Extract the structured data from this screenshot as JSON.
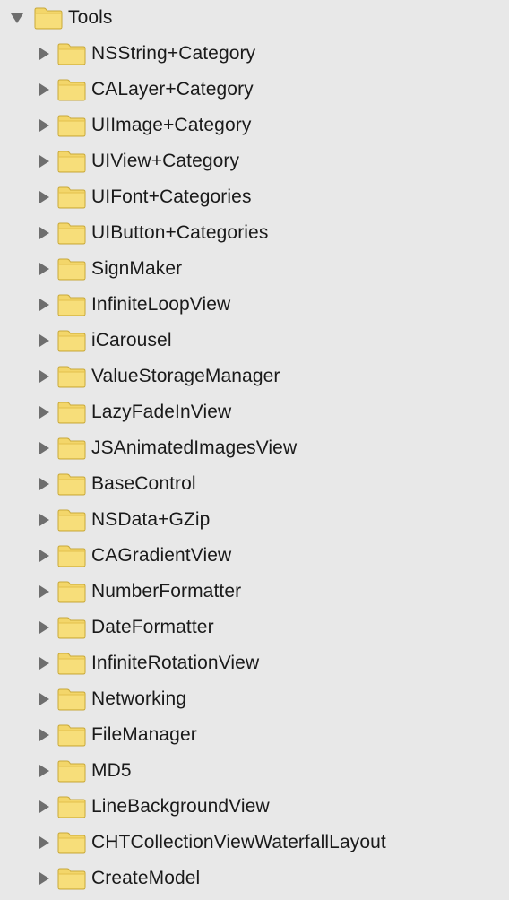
{
  "root": {
    "label": "Tools",
    "expanded": true,
    "icon": "folder-icon",
    "disclosure_icon": "triangle-down-icon"
  },
  "children": [
    {
      "label": "NSString+Category",
      "icon": "folder-icon",
      "expanded": false
    },
    {
      "label": "CALayer+Category",
      "icon": "folder-icon",
      "expanded": false
    },
    {
      "label": "UIImage+Category",
      "icon": "folder-icon",
      "expanded": false
    },
    {
      "label": "UIView+Category",
      "icon": "folder-icon",
      "expanded": false
    },
    {
      "label": "UIFont+Categories",
      "icon": "folder-icon",
      "expanded": false
    },
    {
      "label": "UIButton+Categories",
      "icon": "folder-icon",
      "expanded": false
    },
    {
      "label": "SignMaker",
      "icon": "folder-icon",
      "expanded": false
    },
    {
      "label": "InfiniteLoopView",
      "icon": "folder-icon",
      "expanded": false
    },
    {
      "label": "iCarousel",
      "icon": "folder-icon",
      "expanded": false
    },
    {
      "label": "ValueStorageManager",
      "icon": "folder-icon",
      "expanded": false
    },
    {
      "label": "LazyFadeInView",
      "icon": "folder-icon",
      "expanded": false
    },
    {
      "label": "JSAnimatedImagesView",
      "icon": "folder-icon",
      "expanded": false
    },
    {
      "label": "BaseControl",
      "icon": "folder-icon",
      "expanded": false
    },
    {
      "label": "NSData+GZip",
      "icon": "folder-icon",
      "expanded": false
    },
    {
      "label": "CAGradientView",
      "icon": "folder-icon",
      "expanded": false
    },
    {
      "label": "NumberFormatter",
      "icon": "folder-icon",
      "expanded": false
    },
    {
      "label": "DateFormatter",
      "icon": "folder-icon",
      "expanded": false
    },
    {
      "label": "InfiniteRotationView",
      "icon": "folder-icon",
      "expanded": false
    },
    {
      "label": "Networking",
      "icon": "folder-icon",
      "expanded": false
    },
    {
      "label": "FileManager",
      "icon": "folder-icon",
      "expanded": false
    },
    {
      "label": "MD5",
      "icon": "folder-icon",
      "expanded": false
    },
    {
      "label": "LineBackgroundView",
      "icon": "folder-icon",
      "expanded": false
    },
    {
      "label": "CHTCollectionViewWaterfallLayout",
      "icon": "folder-icon",
      "expanded": false
    },
    {
      "label": "CreateModel",
      "icon": "folder-icon",
      "expanded": false
    }
  ],
  "colors": {
    "background": "#e8e8e8",
    "text": "#1a1a1a",
    "disclosure": "#6e6e6e",
    "folder_fill": "#f3d66a",
    "folder_tab": "#e9c64a",
    "folder_edge": "#c9a93a"
  }
}
